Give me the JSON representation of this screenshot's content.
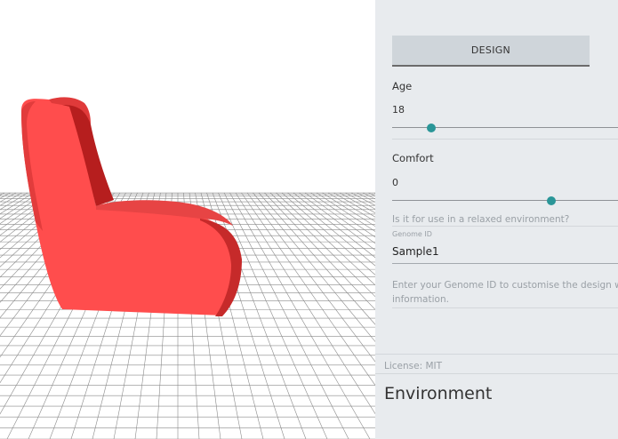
{
  "panel": {
    "design_button": "DESIGN",
    "age": {
      "label": "Age",
      "value": "18",
      "slider_fraction": 0.17
    },
    "comfort": {
      "label": "Comfort",
      "value": "0",
      "slider_fraction": 0.69
    },
    "comfort_helper": "Is it for use in a relaxed environment?",
    "genome": {
      "label": "Genome ID",
      "value": "Sample1",
      "helper_line1": "Enter your Genome ID to customise the design with",
      "helper_line2": "information."
    },
    "license": "License: MIT",
    "section_title": "Environment"
  },
  "colors": {
    "chair": "#f04848",
    "accent": "#2a9698",
    "panel_bg": "#e8ebee"
  }
}
